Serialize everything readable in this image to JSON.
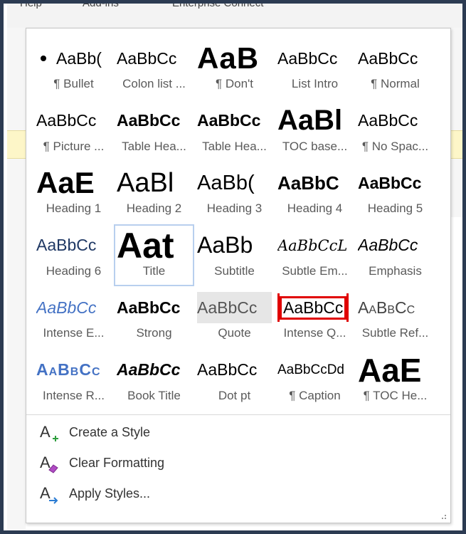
{
  "background": {
    "menu_items": [
      "Help",
      "Add-ins",
      "Enterprise Connect"
    ]
  },
  "styles_gallery": {
    "rows": [
      [
        {
          "sample": "AaBb(",
          "name": "¶ Bullet",
          "style": "s-bullet"
        },
        {
          "sample": "AaBbCc",
          "name": "Colon list ...",
          "style": "s-normal"
        },
        {
          "sample": "AaB",
          "name": "¶ Don't",
          "style": "s-dont"
        },
        {
          "sample": "AaBbCc",
          "name": "List Intro",
          "style": "s-normal"
        },
        {
          "sample": "AaBbCc",
          "name": "¶ Normal",
          "style": "s-normal"
        }
      ],
      [
        {
          "sample": "AaBbCc",
          "name": "¶ Picture ...",
          "style": "s-normal"
        },
        {
          "sample": "AaBbCc",
          "name": "Table Hea...",
          "style": "s-bold"
        },
        {
          "sample": "AaBbCc",
          "name": "Table Hea...",
          "style": "s-bold"
        },
        {
          "sample": "AaBl",
          "name": "TOC base...",
          "style": "s-toc"
        },
        {
          "sample": "AaBbCc",
          "name": "¶ No Spac...",
          "style": "s-normal"
        }
      ],
      [
        {
          "sample": "AaE",
          "name": "Heading 1",
          "style": "s-h1"
        },
        {
          "sample": "AaBl",
          "name": "Heading 2",
          "style": "s-h2"
        },
        {
          "sample": "AaBb(",
          "name": "Heading 3",
          "style": "s-h3"
        },
        {
          "sample": "AaBbC",
          "name": "Heading 4",
          "style": "s-h4"
        },
        {
          "sample": "AaBbCc",
          "name": "Heading 5",
          "style": "s-h5"
        }
      ],
      [
        {
          "sample": "AaBbCc",
          "name": "Heading 6",
          "style": "s-h6"
        },
        {
          "sample": "Aat",
          "name": "Title",
          "style": "s-title",
          "selected": true
        },
        {
          "sample": "AaBb",
          "name": "Subtitle",
          "style": "s-subtitle"
        },
        {
          "sample": "AaBbCcL",
          "name": "Subtle Em...",
          "style": "s-subtle-em"
        },
        {
          "sample": "AaBbCc",
          "name": "Emphasis",
          "style": "s-emphasis"
        }
      ],
      [
        {
          "sample": "AaBbCc",
          "name": "Intense E...",
          "style": "s-intense-em"
        },
        {
          "sample": "AaBbCc",
          "name": "Strong",
          "style": "s-strong"
        },
        {
          "sample": "AaBbCc",
          "name": "Quote",
          "style": "s-quote",
          "shaded": true
        },
        {
          "sample": "AaBbCc",
          "name": "Intense Q...",
          "style": "s-intense-q",
          "boxed": true
        },
        {
          "sample": "AaBbCc",
          "name": "Subtle Ref...",
          "style": "s-subtle-ref"
        }
      ],
      [
        {
          "sample": "AaBbCc",
          "name": "Intense R...",
          "style": "s-intense-ref"
        },
        {
          "sample": "AaBbCc",
          "name": "Book Title",
          "style": "s-book"
        },
        {
          "sample": "AaBbCc",
          "name": "Dot pt",
          "style": "s-dotpt"
        },
        {
          "sample": "AaBbCcDd",
          "name": "¶ Caption",
          "style": "s-caption"
        },
        {
          "sample": "AaE",
          "name": "¶ TOC He...",
          "style": "s-tochead"
        }
      ]
    ]
  },
  "commands": [
    {
      "label": "Create a Style",
      "icon": "create-style-icon",
      "accent": "#2e9e3e"
    },
    {
      "label": "Clear Formatting",
      "icon": "clear-formatting-icon",
      "accent": "#b04bc4"
    },
    {
      "label": "Apply Styles...",
      "icon": "apply-styles-icon",
      "accent": "#2b7cd3"
    }
  ],
  "colors": {
    "frame": "#2c3b52",
    "selected_border": "#b8cfee",
    "intense_quote_red": "#e00000",
    "accent_blue": "#4472c4"
  }
}
